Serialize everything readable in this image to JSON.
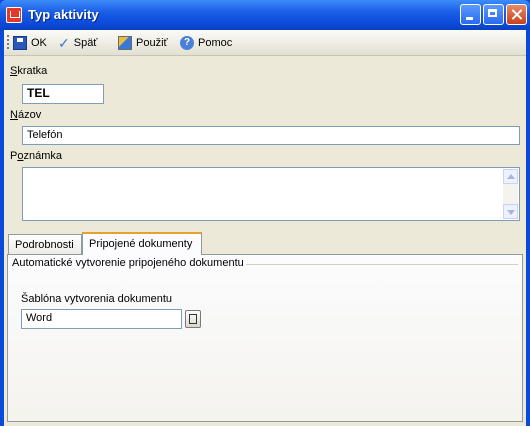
{
  "window": {
    "title": "Typ aktivity"
  },
  "toolbar": {
    "ok_label": "OK",
    "back_label": "Späť",
    "apply_label": "Použiť",
    "help_label": "Pomoc"
  },
  "form": {
    "abbr_label_key": "S",
    "abbr_label_rest": "kratka",
    "abbr_value": "TEL",
    "name_label_key": "N",
    "name_label_rest": "ázov",
    "name_value": "Telefón",
    "note_label_pre": "P",
    "note_label_key": "o",
    "note_label_rest": "známka",
    "note_value": ""
  },
  "tabs": [
    {
      "label": "Podrobnosti",
      "active": false
    },
    {
      "label": "Pripojené dokumenty",
      "active": true
    }
  ],
  "panel": {
    "group_title": "Automatické vytvorenie pripojeného dokumentu",
    "template_label": "Šablóna vytvorenia dokumentu",
    "template_value": "Word"
  },
  "colors": {
    "titlebar": "#0a4ad8",
    "client": "#ece9d8",
    "tab_accent": "#e8a030"
  }
}
